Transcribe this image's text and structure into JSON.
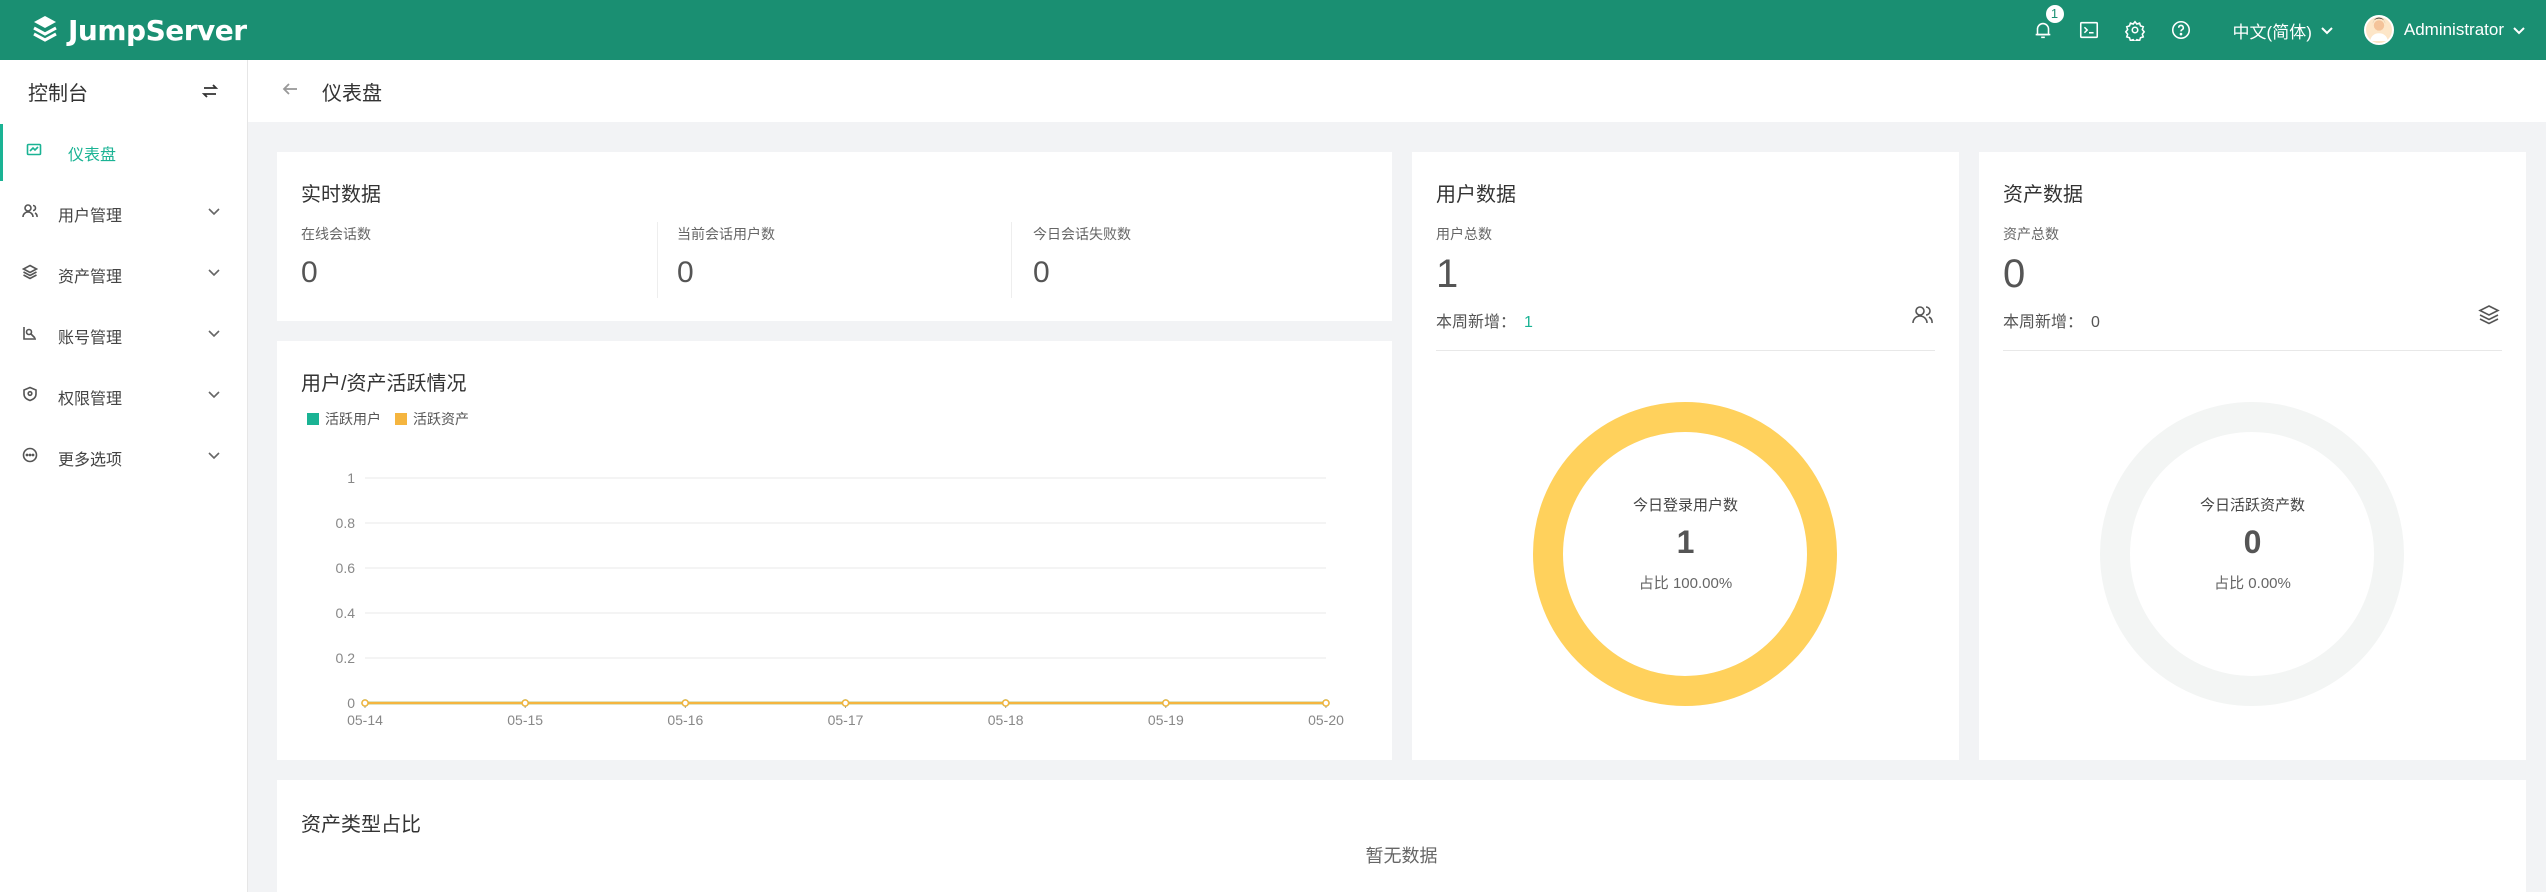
{
  "app": {
    "name": "JumpServer"
  },
  "topbar": {
    "notification_count": "1",
    "language": "中文(简体)",
    "username": "Administrator"
  },
  "sidebar": {
    "title": "控制台",
    "items": [
      {
        "label": "仪表盘",
        "icon": "dashboard-icon",
        "active": true
      },
      {
        "label": "用户管理",
        "icon": "users-icon"
      },
      {
        "label": "资产管理",
        "icon": "layers-icon"
      },
      {
        "label": "账号管理",
        "icon": "account-icon"
      },
      {
        "label": "权限管理",
        "icon": "shield-icon"
      },
      {
        "label": "更多选项",
        "icon": "more-icon"
      }
    ]
  },
  "page": {
    "title": "仪表盘"
  },
  "realtime": {
    "title": "实时数据",
    "metrics": [
      {
        "label": "在线会话数",
        "value": "0"
      },
      {
        "label": "当前会话用户数",
        "value": "0"
      },
      {
        "label": "今日会话失败数",
        "value": "0"
      }
    ]
  },
  "activity": {
    "title": "用户/资产活跃情况",
    "legend": [
      {
        "name": "活跃用户",
        "color": "#1ab394"
      },
      {
        "name": "活跃资产",
        "color": "#f5b53f"
      }
    ]
  },
  "chart_data": {
    "type": "line",
    "x": [
      "05-14",
      "05-15",
      "05-16",
      "05-17",
      "05-18",
      "05-19",
      "05-20"
    ],
    "series": [
      {
        "name": "活跃用户",
        "values": [
          0,
          0,
          0,
          0,
          0,
          0,
          0
        ],
        "color": "#1ab394"
      },
      {
        "name": "活跃资产",
        "values": [
          0,
          0,
          0,
          0,
          0,
          0,
          0
        ],
        "color": "#f5b53f"
      }
    ],
    "yticks": [
      "0",
      "0.2",
      "0.4",
      "0.6",
      "0.8",
      "1"
    ],
    "ylim": [
      0,
      1
    ],
    "grid": true,
    "legend": "top-left"
  },
  "users": {
    "title": "用户数据",
    "total_label": "用户总数",
    "total": "1",
    "weekly_label": "本周新增：",
    "weekly": "1",
    "donut": {
      "label": "今日登录用户数",
      "value": "1",
      "ratio": "占比 100.00%",
      "percent": 100,
      "color": "#ffd15c"
    }
  },
  "assets": {
    "title": "资产数据",
    "total_label": "资产总数",
    "total": "0",
    "weekly_label": "本周新增：",
    "weekly": "0",
    "donut": {
      "label": "今日活跃资产数",
      "value": "0",
      "ratio": "占比 0.00%",
      "percent": 0,
      "color": "#f3f5f4"
    }
  },
  "asset_types": {
    "title": "资产类型占比",
    "empty_text": "暂无数据"
  }
}
